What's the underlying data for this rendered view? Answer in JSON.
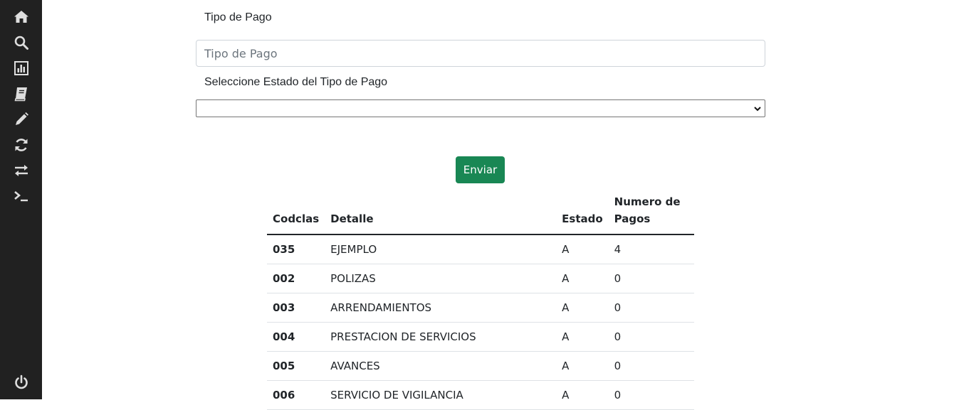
{
  "sidebar": {
    "icons": [
      "home-icon",
      "search-icon",
      "chart-icon",
      "book-icon",
      "pencil-icon",
      "sync-icon",
      "exchange-icon",
      "terminal-icon",
      "power-icon"
    ]
  },
  "form": {
    "tipo_label": "Tipo de Pago",
    "tipo_placeholder": "Tipo de Pago",
    "tipo_value": "",
    "estado_label": "Seleccione Estado del Tipo de Pago",
    "estado_selected": "",
    "submit_label": "Enviar"
  },
  "table": {
    "headers": [
      "Codclas",
      "Detalle",
      "Estado",
      "Numero de Pagos"
    ],
    "rows": [
      {
        "codclas": "035",
        "detalle": "EJEMPLO",
        "estado": "A",
        "pagos": "4"
      },
      {
        "codclas": "002",
        "detalle": "POLIZAS",
        "estado": "A",
        "pagos": "0"
      },
      {
        "codclas": "003",
        "detalle": "ARRENDAMIENTOS",
        "estado": "A",
        "pagos": "0"
      },
      {
        "codclas": "004",
        "detalle": "PRESTACION DE SERVICIOS",
        "estado": "A",
        "pagos": "0"
      },
      {
        "codclas": "005",
        "detalle": "AVANCES",
        "estado": "A",
        "pagos": "0"
      },
      {
        "codclas": "006",
        "detalle": "SERVICIO DE VIGILANCIA",
        "estado": "A",
        "pagos": "0"
      }
    ]
  },
  "colors": {
    "sidebar_bg": "#212121",
    "icon_color": "#dedede",
    "button_bg": "#198754"
  }
}
